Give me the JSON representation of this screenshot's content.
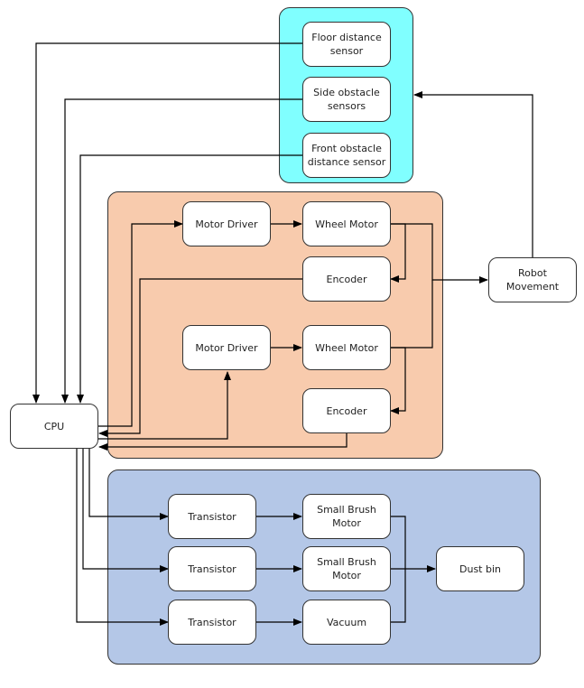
{
  "colors": {
    "sensors_group": "#80FFFF",
    "motor_group": "#F8CBAD",
    "cleaning_group": "#B4C7E7",
    "line": "#000000"
  },
  "groups": {
    "sensors": "sensors",
    "motors": "motor-control",
    "cleaning": "cleaning"
  },
  "nodes": {
    "floor_sensor": "Floor distance\nsensor",
    "side_sensors": "Side obstacle\nsensors",
    "front_sensor": "Front obstacle\ndistance sensor",
    "motor_driver_1": "Motor Driver",
    "wheel_motor_1": "Wheel Motor",
    "encoder_1": "Encoder",
    "motor_driver_2": "Motor Driver",
    "wheel_motor_2": "Wheel Motor",
    "encoder_2": "Encoder",
    "robot_movement": "Robot\nMovement",
    "cpu": "CPU",
    "transistor_1": "Transistor",
    "transistor_2": "Transistor",
    "transistor_3": "Transistor",
    "small_brush_motor_1": "Small Brush\nMotor",
    "small_brush_motor_2": "Small Brush\nMotor",
    "vacuum": "Vacuum",
    "dust_bin": "Dust bin"
  },
  "edges": [
    {
      "from": "floor_sensor",
      "to": "cpu"
    },
    {
      "from": "side_sensors",
      "to": "cpu"
    },
    {
      "from": "front_sensor",
      "to": "cpu"
    },
    {
      "from": "cpu",
      "to": "motor_driver_1"
    },
    {
      "from": "motor_driver_1",
      "to": "wheel_motor_1"
    },
    {
      "from": "wheel_motor_1",
      "to": "encoder_1"
    },
    {
      "from": "encoder_1",
      "to": "cpu"
    },
    {
      "from": "cpu",
      "to": "motor_driver_2"
    },
    {
      "from": "motor_driver_2",
      "to": "wheel_motor_2"
    },
    {
      "from": "wheel_motor_2",
      "to": "encoder_2"
    },
    {
      "from": "encoder_2",
      "to": "cpu"
    },
    {
      "from": "wheel_motor_1",
      "to": "robot_movement"
    },
    {
      "from": "wheel_motor_2",
      "to": "robot_movement"
    },
    {
      "from": "robot_movement",
      "to": "sensors"
    },
    {
      "from": "cpu",
      "to": "transistor_1"
    },
    {
      "from": "cpu",
      "to": "transistor_2"
    },
    {
      "from": "cpu",
      "to": "transistor_3"
    },
    {
      "from": "transistor_1",
      "to": "small_brush_motor_1"
    },
    {
      "from": "transistor_2",
      "to": "small_brush_motor_2"
    },
    {
      "from": "transistor_3",
      "to": "vacuum"
    },
    {
      "from": "small_brush_motor_1",
      "to": "dust_bin"
    },
    {
      "from": "small_brush_motor_2",
      "to": "dust_bin"
    },
    {
      "from": "vacuum",
      "to": "dust_bin"
    }
  ]
}
